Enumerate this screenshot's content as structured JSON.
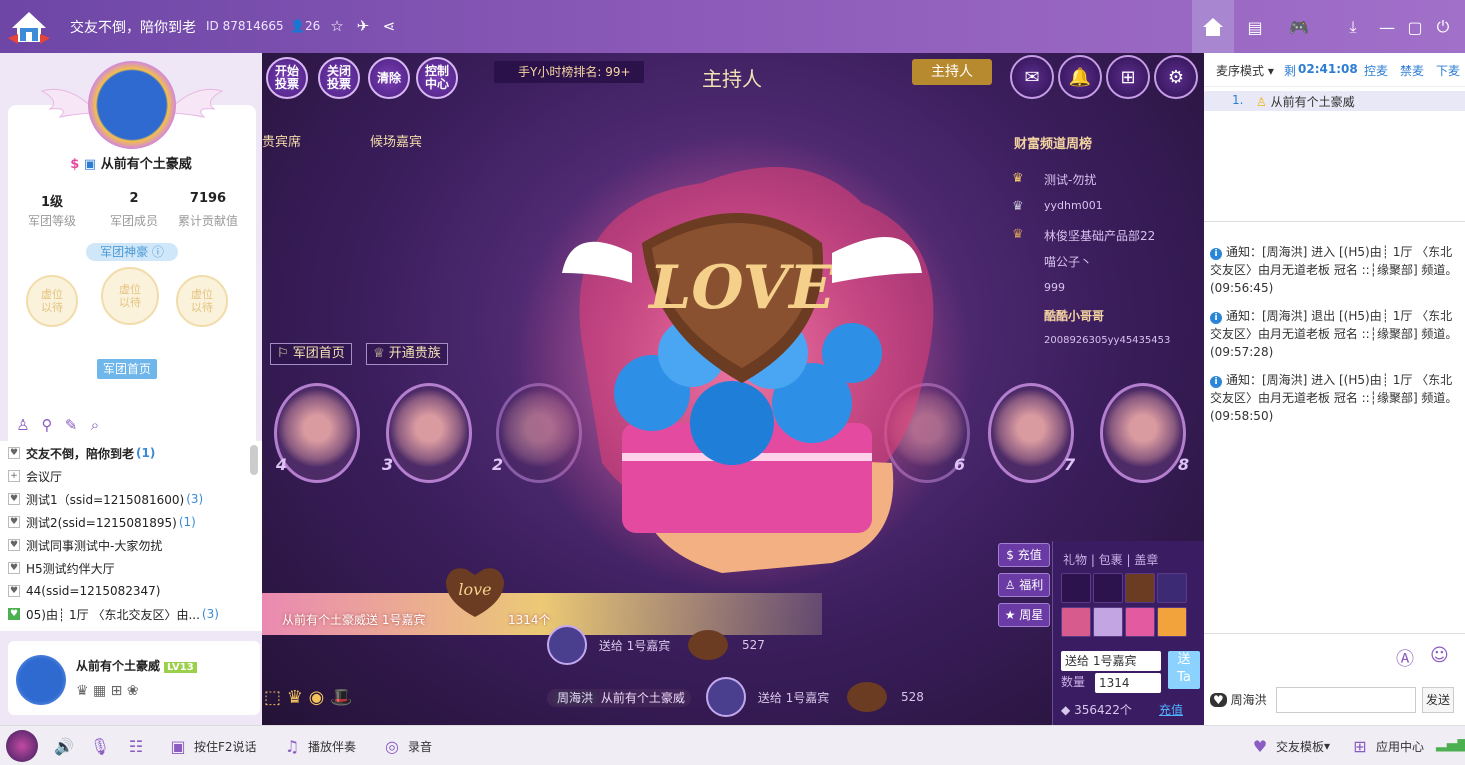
{
  "titlebar": {
    "title": "交友不倒，陪你到老",
    "id": "ID 87814665",
    "online": "26"
  },
  "left": {
    "profile": {
      "name": "从前有个土豪威",
      "level_value": "1级",
      "level_label": "军团等级",
      "members_value": "2",
      "members_label": "军团成员",
      "contrib_value": "7196",
      "contrib_label": "累计贡献值",
      "god_pill": "军团神豪",
      "slot_1": "虚位\n以待",
      "slot_2": "虚位\n以待",
      "slot_3": "虚位\n以待",
      "home_button": "军团首页"
    },
    "channels": [
      {
        "name": "交友不倒，陪你到老",
        "count": "(1)"
      },
      {
        "name": "会议厅",
        "count": ""
      },
      {
        "name": "测试1（ssid=1215081600)",
        "count": "(3)"
      },
      {
        "name": "测试2(ssid=1215081895)",
        "count": "(1)"
      },
      {
        "name": "测试同事测试中-大家勿扰",
        "count": ""
      },
      {
        "name": "H5测试约伴大厅",
        "count": ""
      },
      {
        "name": "44(ssid=1215082347)",
        "count": ""
      },
      {
        "name": "05)由┊ 1厅 〈东北交友区〉由...",
        "count": "(3)"
      }
    ],
    "me": {
      "name": "从前有个土豪威",
      "level": "LV13"
    }
  },
  "stage": {
    "buttons": [
      "开始\n投票",
      "关闭\n投票",
      "清除",
      "控制\n中心"
    ],
    "rank": "手Y小时榜排名: 99+",
    "host_title": "主持人",
    "host_tag": "主持人",
    "tab_guest": "贵宾席",
    "tab_field": "候场嘉宾",
    "wealth_title": "财富频道周榜",
    "wealth_rows": [
      "测试-勿扰",
      "yydhm001",
      "林俊坚基础产品部22",
      "喵公子丶",
      "999",
      "酷酷小哥哥",
      "2008926305yy45435453"
    ],
    "btn_army": "军团首页",
    "btn_noble": "开通贵族",
    "seats": [
      "4",
      "3",
      "2",
      "6",
      "7",
      "8"
    ],
    "gift_sender": "从前有个土豪威送 1号嘉宾",
    "gift_count": "1314个",
    "feed": [
      {
        "to": "送给 1号嘉宾",
        "num": "527"
      },
      {
        "to": "送给 1号嘉宾",
        "num": "528"
      }
    ],
    "feed_sender_tag": "周海洪",
    "feed_sender_name": "从前有个土豪威",
    "side_buttons": [
      "充值",
      "福利",
      "周星"
    ],
    "gift_tabs": "礼物 | 包裹 | 盖章",
    "send_to": "送给 1号嘉宾",
    "qty_label": "数量",
    "qty_value": "1314",
    "send_btn": "送\nTa",
    "balance": "356422个",
    "recharge": "充值"
  },
  "right": {
    "mode": "麦序模式",
    "time_label": "剩",
    "time": "02:41:08",
    "actions": [
      "控麦",
      "禁麦",
      "下麦"
    ],
    "mic_index": "1.",
    "mic_name": "从前有个土豪威",
    "notices": [
      "通知：[周海洪] 进入 [(H5)由┊ 1厅 〈东北交友区〉由月无道老板 冠名 ::┆缘聚部] 频道。(09:56:45)",
      "通知：[周海洪] 退出 [(H5)由┊ 1厅 〈东北交友区〉由月无道老板 冠名 ::┆缘聚部] 频道。(09:57:28)",
      "通知：[周海洪] 进入 [(H5)由┊ 1厅 〈东北交友区〉由月无道老板 冠名 ::┆缘聚部] 频道。(09:58:50)"
    ],
    "chat_target": "周海洪",
    "send": "发送"
  },
  "bottombar": {
    "f2": "按住F2说话",
    "music": "播放伴奏",
    "record": "录音",
    "template": "交友模板",
    "apps": "应用中心"
  }
}
